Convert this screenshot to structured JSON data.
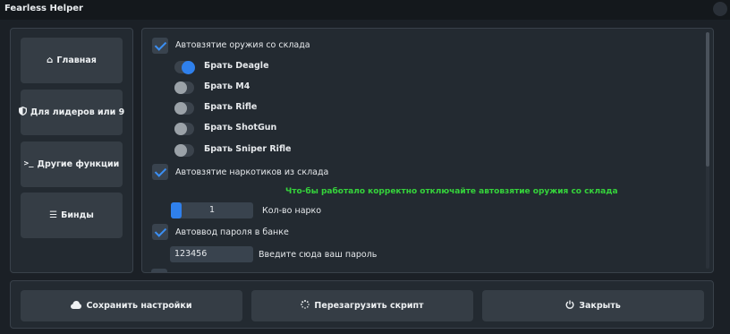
{
  "window": {
    "title": "Fearless Helper"
  },
  "sidebar": {
    "items": [
      {
        "label": "Главная",
        "icon": "home-icon"
      },
      {
        "label": "Для лидеров или 9",
        "icon": "shield-icon"
      },
      {
        "label": "Другие функции",
        "icon": "terminal-icon"
      },
      {
        "label": "Бинды",
        "icon": "menu-icon"
      }
    ]
  },
  "content": {
    "weapons": {
      "label": "Автовзятие оружия со склада",
      "checked": true,
      "options": [
        {
          "label": "Брать Deagle",
          "on": true
        },
        {
          "label": "Брать M4",
          "on": false
        },
        {
          "label": "Брать Rifle",
          "on": false
        },
        {
          "label": "Брать ShotGun",
          "on": false
        },
        {
          "label": "Брать Sniper Rifle",
          "on": false
        }
      ]
    },
    "drugs": {
      "label": "Автовзятие наркотиков из склада",
      "checked": true,
      "hint": "Что-бы работало корректно отключайте автовзятие оружия со склада",
      "count_value": "1",
      "count_label": "Кол-во нарко"
    },
    "bank": {
      "label": "Автоввод пароля в банке",
      "checked": true,
      "password_value": "123456",
      "password_label": "Введите сюда ваш пароль"
    }
  },
  "bottom": {
    "save_label": "Сохранить настройки",
    "reload_label": "Перезагрузить скрипт",
    "close_label": "Закрыть"
  },
  "colors": {
    "accent": "#2f80ec",
    "hint": "#35d43b",
    "background": "#1b2026",
    "button": "#353d45"
  }
}
